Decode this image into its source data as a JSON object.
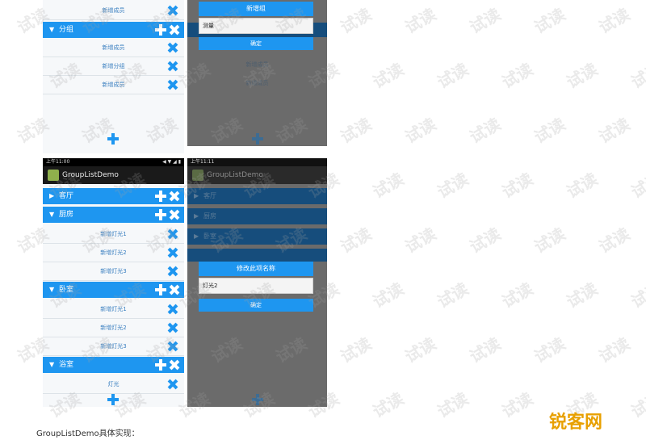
{
  "watermark": "试读",
  "panel_tl": {
    "child_top": "新增成员",
    "group": "分组",
    "children": [
      "新增成员",
      "新增分组",
      "新增成员"
    ]
  },
  "panel_tr": {
    "dialog_title": "新增组",
    "input_value": "测量",
    "button": "确定",
    "bg_children": [
      "新增成员",
      "新增成员"
    ]
  },
  "panel_bl": {
    "status_left": "上午11:00",
    "status_right": "◀ ▼ ◢ ▮",
    "title": "GroupListDemo",
    "groups": [
      {
        "label": "客厅",
        "children": []
      },
      {
        "label": "厨房",
        "children": [
          "新增灯光1",
          "新增灯光2",
          "新增灯光3"
        ]
      },
      {
        "label": "卧室",
        "children": [
          "新增灯光1",
          "新增灯光2",
          "新增灯光3"
        ]
      },
      {
        "label": "浴室",
        "children": [
          "灯光"
        ]
      }
    ]
  },
  "panel_br": {
    "status_left": "上午11:11",
    "title": "GroupListDemo",
    "bg_groups": [
      "客厅",
      "厨房",
      "卧室"
    ],
    "dialog_title": "修改此项名称",
    "input_value": "灯光2",
    "button": "确定"
  },
  "caption": "GroupListDemo具体实现：",
  "logo": "锐客网",
  "colors": {
    "accent": "#1e96f0",
    "overlay": "#6b6b6b",
    "logo": "#e8a000"
  }
}
